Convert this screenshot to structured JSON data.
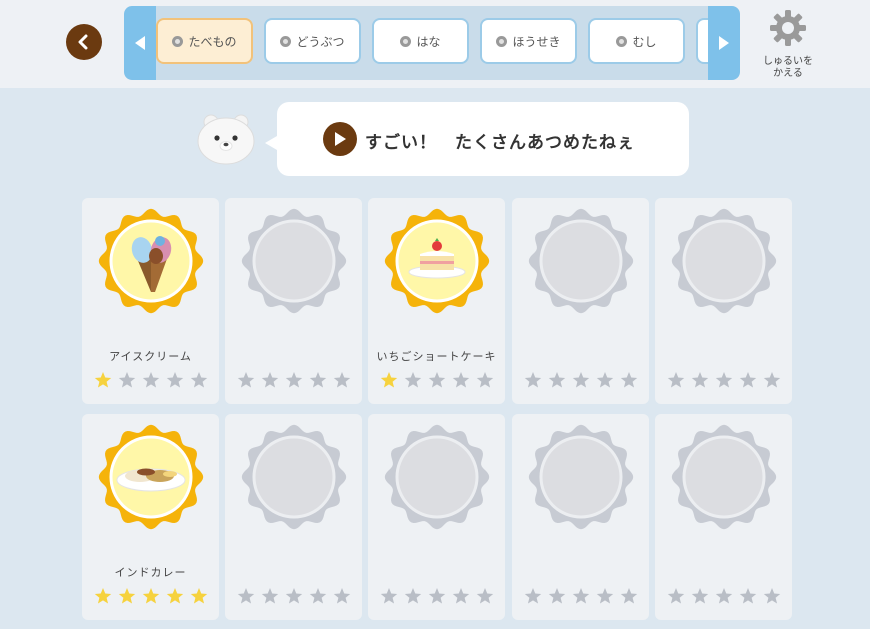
{
  "header": {
    "tabs": [
      {
        "label": "たべもの",
        "icon": "food-icon",
        "active": true
      },
      {
        "label": "どうぶつ",
        "icon": "animal-icon",
        "active": false
      },
      {
        "label": "はな",
        "icon": "flower-icon",
        "active": false
      },
      {
        "label": "ほうせき",
        "icon": "gem-icon",
        "active": false
      },
      {
        "label": "むし",
        "icon": "insect-icon",
        "active": false
      }
    ],
    "settings_label": "しゅるいを\nかえる"
  },
  "message": {
    "text": "すごい！　たくさんあつめたねぇ"
  },
  "cards": [
    {
      "name": "アイスクリーム",
      "collected": true,
      "item": "ice-cream",
      "stars": 1
    },
    {
      "name": "",
      "collected": false,
      "stars": 0
    },
    {
      "name": "いちごショートケーキ",
      "collected": true,
      "item": "cake",
      "stars": 1
    },
    {
      "name": "",
      "collected": false,
      "stars": 0
    },
    {
      "name": "",
      "collected": false,
      "stars": 0
    },
    {
      "name": "インドカレー",
      "collected": true,
      "item": "curry",
      "stars": 5
    },
    {
      "name": "",
      "collected": false,
      "stars": 0
    },
    {
      "name": "",
      "collected": false,
      "stars": 0
    },
    {
      "name": "",
      "collected": false,
      "stars": 0
    },
    {
      "name": "",
      "collected": false,
      "stars": 0
    }
  ],
  "colors": {
    "accent_brown": "#6b3a10",
    "gold": "#f5b30a",
    "star_on": "#f6d23e",
    "star_off": "#b9bec6",
    "tab_arrow": "#7ec1ea"
  }
}
